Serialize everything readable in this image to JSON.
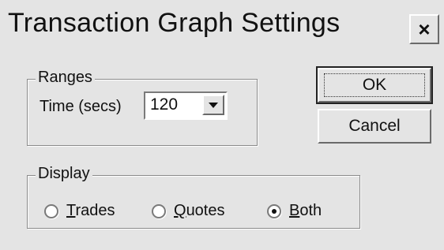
{
  "window": {
    "title": "Transaction Graph Settings",
    "close_label": "×"
  },
  "ranges": {
    "group_label": "Ranges",
    "time_label": "Time (secs)",
    "time_value": "120"
  },
  "buttons": {
    "ok": "OK",
    "cancel": "Cancel"
  },
  "display": {
    "group_label": "Display",
    "options": [
      {
        "label": "Trades",
        "checked": false
      },
      {
        "label": "Quotes",
        "checked": false
      },
      {
        "label": "Both",
        "checked": true
      }
    ]
  }
}
